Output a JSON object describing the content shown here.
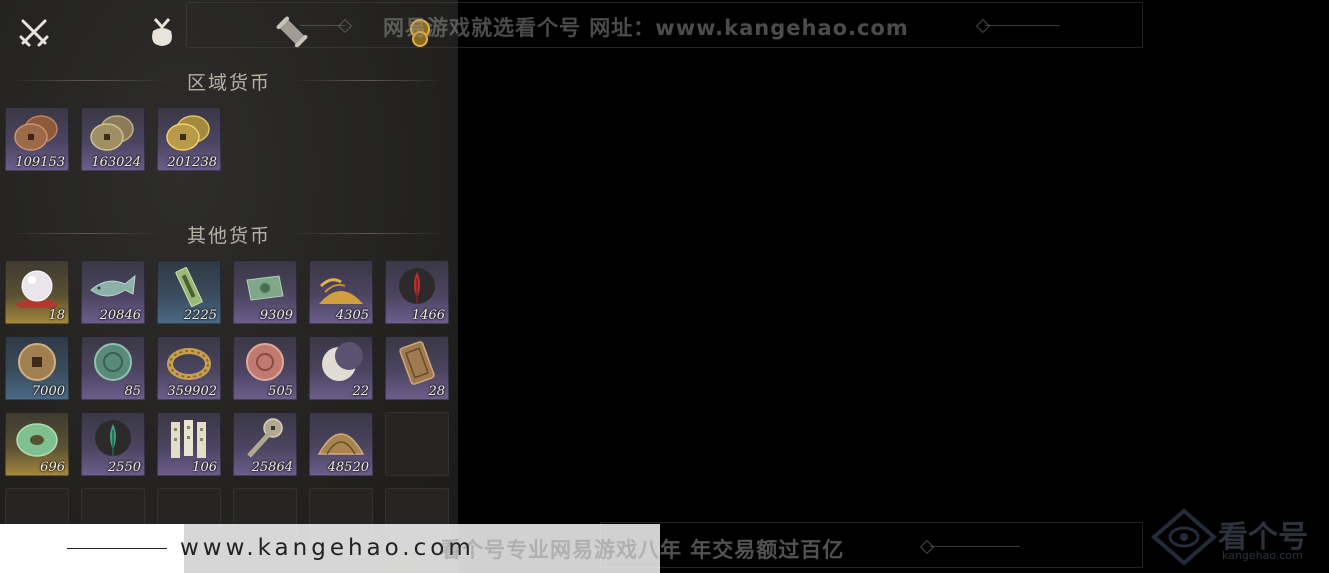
{
  "tabs": [
    {
      "icon": "crossed-swords-icon"
    },
    {
      "icon": "pouch-icon"
    },
    {
      "icon": "scroll-icon"
    },
    {
      "icon": "coin-tab-icon"
    }
  ],
  "sections": {
    "regional": {
      "title": "区域货币",
      "items": [
        {
          "icon": "copper-coins-icon",
          "qty": "109153",
          "rarity": "purple"
        },
        {
          "icon": "silver-coins-icon",
          "qty": "163024",
          "rarity": "purple"
        },
        {
          "icon": "gold-coins-icon",
          "qty": "201238",
          "rarity": "purple"
        }
      ]
    },
    "other": {
      "title": "其他货币",
      "rows": [
        [
          {
            "icon": "pearl-icon",
            "qty": "18",
            "rarity": "gold"
          },
          {
            "icon": "jade-fish-icon",
            "qty": "20846",
            "rarity": "purple"
          },
          {
            "icon": "jade-token-icon",
            "qty": "2225",
            "rarity": "blue"
          },
          {
            "icon": "banknote-icon",
            "qty": "9309",
            "rarity": "purple"
          },
          {
            "icon": "grain-pile-icon",
            "qty": "4305",
            "rarity": "purple"
          },
          {
            "icon": "red-feather-icon",
            "qty": "1466",
            "rarity": "purple"
          }
        ],
        [
          {
            "icon": "bronze-coin-icon",
            "qty": "7000",
            "rarity": "blue"
          },
          {
            "icon": "jade-medallion-icon",
            "qty": "85",
            "rarity": "purple"
          },
          {
            "icon": "gold-bracelet-icon",
            "qty": "359902",
            "rarity": "purple"
          },
          {
            "icon": "pink-medallion-icon",
            "qty": "505",
            "rarity": "purple"
          },
          {
            "icon": "crescent-moon-icon",
            "qty": "22",
            "rarity": "purple"
          },
          {
            "icon": "bronze-plaque-icon",
            "qty": "28",
            "rarity": "purple"
          }
        ],
        [
          {
            "icon": "jade-disc-icon",
            "qty": "696",
            "rarity": "gold"
          },
          {
            "icon": "green-feather-icon",
            "qty": "2550",
            "rarity": "purple"
          },
          {
            "icon": "bamboo-slips-icon",
            "qty": "106",
            "rarity": "purple"
          },
          {
            "icon": "spade-coin-icon",
            "qty": "25864",
            "rarity": "purple"
          },
          {
            "icon": "bronze-fan-icon",
            "qty": "48520",
            "rarity": "purple"
          },
          {
            "icon": "",
            "qty": "",
            "rarity": "empty"
          }
        ]
      ]
    }
  },
  "watermark": {
    "top": "网易游戏就选看个号   网址：www.kangehao.com",
    "bottom": "看个号专业网易游戏八年   年交易额过百亿",
    "url": "www.kangehao.com",
    "logo_main": "看个号",
    "logo_sub": "kangehao.com"
  },
  "colors": {
    "rarity_purple": "#6c5e8c",
    "rarity_gold": "#a5893d",
    "rarity_blue": "#4b6a86"
  }
}
